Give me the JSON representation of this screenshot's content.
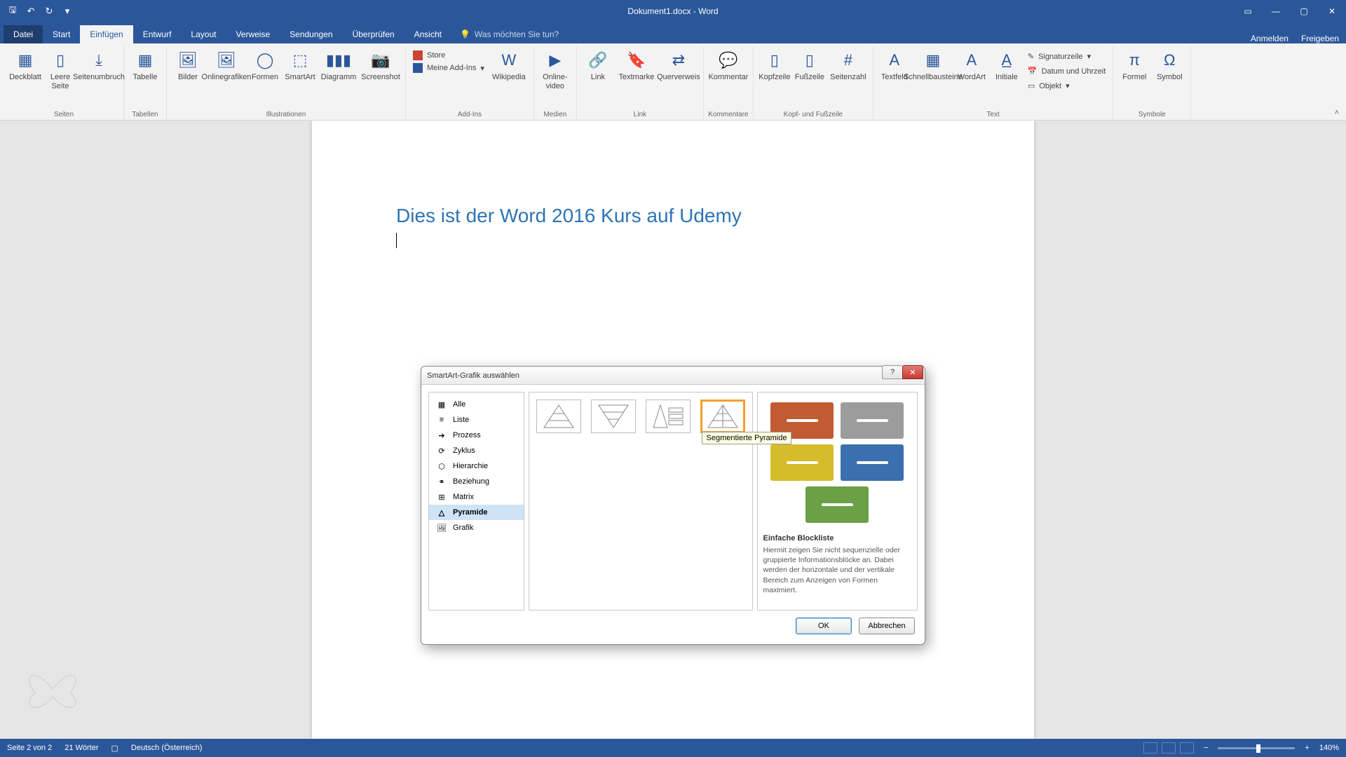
{
  "titlebar": {
    "doc_title": "Dokument1.docx - Word"
  },
  "tabs": {
    "file": "Datei",
    "start": "Start",
    "insert": "Einfügen",
    "design": "Entwurf",
    "layout": "Layout",
    "references": "Verweise",
    "mailings": "Sendungen",
    "review": "Überprüfen",
    "view": "Ansicht",
    "tell_me": "Was möchten Sie tun?",
    "sign_in": "Anmelden",
    "share": "Freigeben"
  },
  "ribbon": {
    "pages": {
      "cover": "Deckblatt",
      "blank": "Leere Seite",
      "break": "Seitenumbruch",
      "group": "Seiten"
    },
    "tables": {
      "table": "Tabelle",
      "group": "Tabellen"
    },
    "illus": {
      "pictures": "Bilder",
      "online": "Onlinegrafiken",
      "shapes": "Formen",
      "smartart": "SmartArt",
      "chart": "Diagramm",
      "screenshot": "Screenshot",
      "group": "Illustrationen"
    },
    "addins": {
      "store": "Store",
      "my": "Meine Add-Ins",
      "wiki": "Wikipedia",
      "group": "Add-Ins"
    },
    "media": {
      "video": "Online-video",
      "group": "Medien"
    },
    "links": {
      "link": "Link",
      "bookmark": "Textmarke",
      "cross": "Querverweis",
      "group": "Link"
    },
    "comments": {
      "comment": "Kommentar",
      "group": "Kommentare"
    },
    "header": {
      "header": "Kopfzeile",
      "footer": "Fußzeile",
      "pagenum": "Seitenzahl",
      "group": "Kopf- und Fußzeile"
    },
    "text": {
      "textbox": "Textfeld",
      "quick": "Schnellbausteine",
      "wordart": "WordArt",
      "dropcap": "Initiale",
      "sig": "Signaturzeile",
      "date": "Datum und Uhrzeit",
      "obj": "Objekt",
      "group": "Text"
    },
    "symbols": {
      "equation": "Formel",
      "symbol": "Symbol",
      "group": "Symbole"
    }
  },
  "document": {
    "heading": "Dies ist der Word 2016 Kurs auf Udemy"
  },
  "dialog": {
    "title": "SmartArt-Grafik auswählen",
    "categories": [
      "Alle",
      "Liste",
      "Prozess",
      "Zyklus",
      "Hierarchie",
      "Beziehung",
      "Matrix",
      "Pyramide",
      "Grafik"
    ],
    "selected_category": "Pyramide",
    "tooltip": "Segmentierte Pyramide",
    "preview": {
      "title": "Einfache Blockliste",
      "desc": "Hiermit zeigen Sie nicht sequenzielle oder gruppierte Informationsblöcke an. Dabei werden der horizontale und der vertikale Bereich zum Anzeigen von Formen maximiert.",
      "colors": [
        "#c25b32",
        "#9c9c9c",
        "#d4bc2a",
        "#3b6fae",
        "#6aa146"
      ]
    },
    "ok": "OK",
    "cancel": "Abbrechen"
  },
  "status": {
    "page": "Seite 2 von 2",
    "words": "21 Wörter",
    "lang": "Deutsch (Österreich)",
    "zoom": "140%"
  }
}
